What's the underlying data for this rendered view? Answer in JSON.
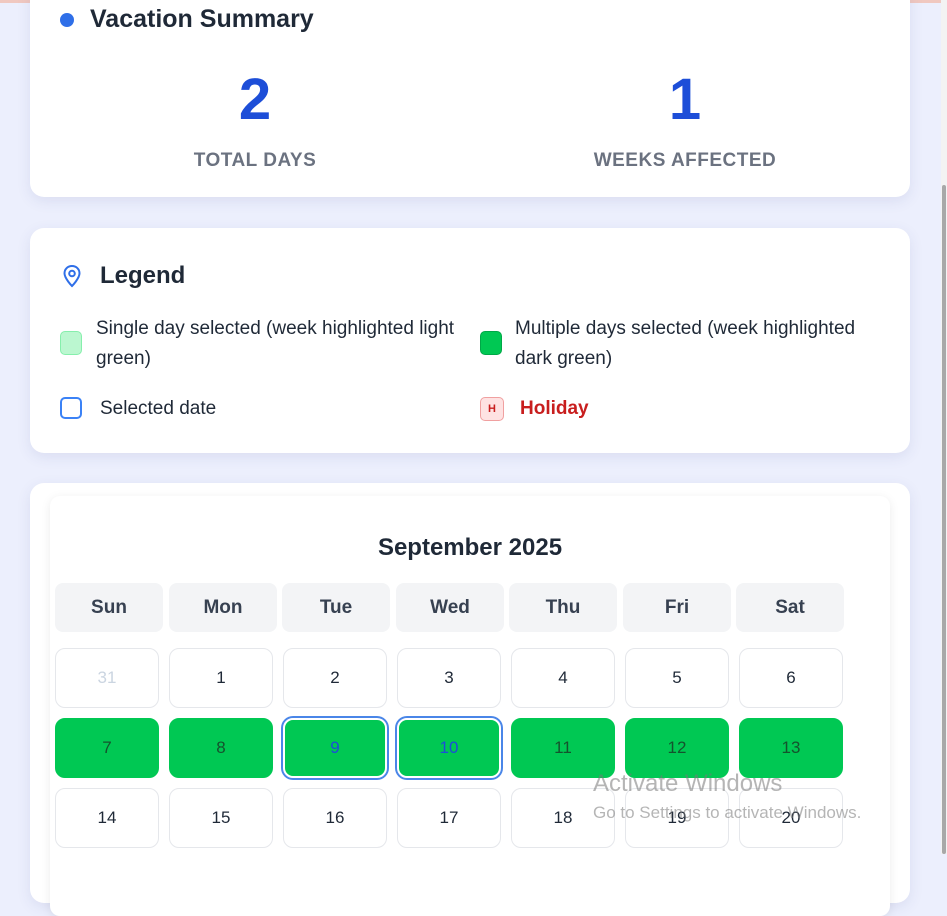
{
  "summary": {
    "title": "Vacation Summary",
    "total_days_value": "2",
    "total_days_label": "TOTAL DAYS",
    "weeks_affected_value": "1",
    "weeks_affected_label": "WEEKS AFFECTED"
  },
  "legend": {
    "title": "Legend",
    "items": [
      {
        "label": "Single day selected (week highlighted light green)",
        "icon": "light-green-swatch"
      },
      {
        "label": "Multiple days selected (week highlighted dark green)",
        "icon": "dark-green-swatch"
      },
      {
        "label": "Selected date",
        "icon": "blue-outline-swatch"
      },
      {
        "label": "Holiday",
        "icon": "holiday-badge",
        "badge": "H"
      }
    ]
  },
  "calendar": {
    "month_title": "September 2025",
    "weekdays": [
      "Sun",
      "Mon",
      "Tue",
      "Wed",
      "Thu",
      "Fri",
      "Sat"
    ],
    "weeks": [
      [
        "31",
        "1",
        "2",
        "3",
        "4",
        "5",
        "6"
      ],
      [
        "7",
        "8",
        "9",
        "10",
        "11",
        "12",
        "13"
      ],
      [
        "14",
        "15",
        "16",
        "17",
        "18",
        "19",
        "20"
      ]
    ],
    "other_month_days": [
      "31"
    ],
    "selected_days": [
      "9",
      "10"
    ],
    "highlighted_week_index": 1
  },
  "watermark": {
    "title": "Activate Windows",
    "subtitle": "Go to Settings to activate Windows."
  },
  "colors": {
    "accent_blue": "#1d4ed8",
    "week_multi_green": "#00c853",
    "week_single_green": "#bbf7d0",
    "holiday_red": "#c81e1e",
    "page_background": "#eceffd"
  }
}
